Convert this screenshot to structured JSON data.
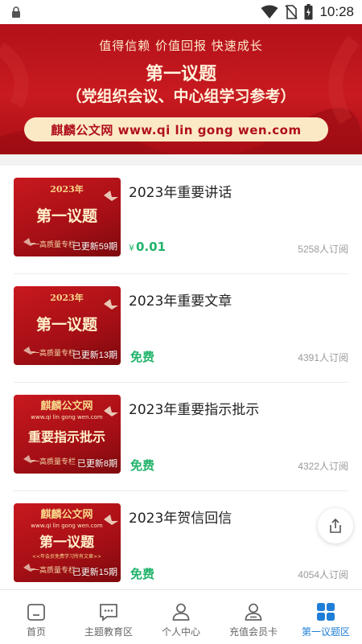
{
  "status_bar": {
    "time": "10:28",
    "icons": [
      "lock-icon",
      "wifi-icon",
      "no-sim-icon",
      "battery-icon"
    ]
  },
  "banner": {
    "slogan": "值得信赖  价值回报  快速成长",
    "title": "第一议题",
    "subtitle": "（党组织会议、中心组学习参考）",
    "url_line": "麒麟公文网  www.qi lin gong wen.com"
  },
  "items": [
    {
      "title": "2023年重要讲话",
      "price": "0.01",
      "price_symbol": "¥",
      "subscribers": "5258人订阅",
      "thumb": {
        "top": "2023年",
        "main": "第一议题",
        "bottom": "一高质量专栏",
        "badge": "已更新59期"
      }
    },
    {
      "title": "2023年重要文章",
      "price": "免费",
      "price_symbol": "",
      "subscribers": "4391人订阅",
      "thumb": {
        "top": "2023年",
        "main": "第一议题",
        "bottom": "一高质量专栏",
        "badge": "已更新13期"
      }
    },
    {
      "title": "2023年重要指示批示",
      "price": "免费",
      "price_symbol": "",
      "subscribers": "4322人订阅",
      "thumb": {
        "top": "麒麟公文网",
        "url": "www.qi lin gong wen.com",
        "main": "重要指示批示",
        "bottom": "一高质量专栏",
        "badge": "已更新8期"
      }
    },
    {
      "title": "2023年贺信回信",
      "price": "免费",
      "price_symbol": "",
      "subscribers": "4054人订阅",
      "thumb": {
        "top": "麒麟公文网",
        "url": "www.qi lin gong wen.com",
        "main": "第一议题",
        "note": "<<年会员免费学习所有文章>>",
        "bottom": "一高质量专栏",
        "badge": "已更新15期"
      }
    }
  ],
  "bottom_nav": [
    {
      "label": "首页",
      "icon": "home-icon"
    },
    {
      "label": "主题教育区",
      "icon": "chat-icon"
    },
    {
      "label": "个人中心",
      "icon": "person-icon"
    },
    {
      "label": "充值会员卡",
      "icon": "member-card-icon"
    },
    {
      "label": "第一议题区",
      "icon": "grid-icon",
      "active": true
    }
  ],
  "colors": {
    "brand_red": "#c81a20",
    "price_green": "#21b36b",
    "active_blue": "#1f7fd8"
  }
}
